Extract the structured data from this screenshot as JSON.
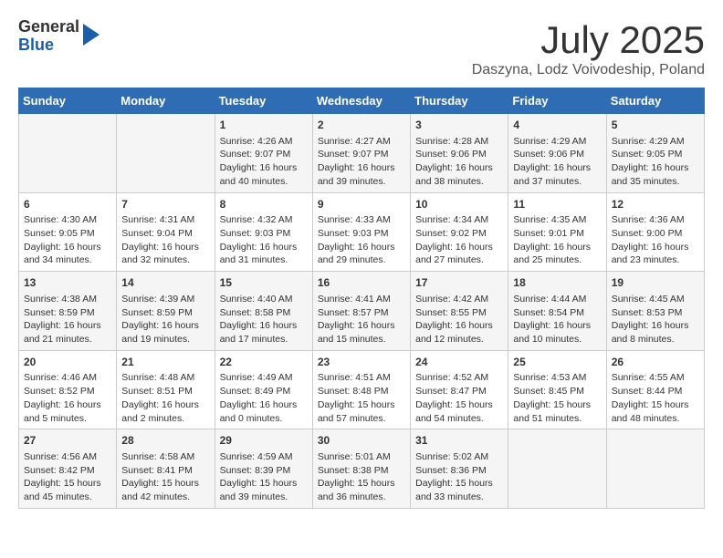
{
  "header": {
    "logo_line1": "General",
    "logo_line2": "Blue",
    "month": "July 2025",
    "location": "Daszyna, Lodz Voivodeship, Poland"
  },
  "days_of_week": [
    "Sunday",
    "Monday",
    "Tuesday",
    "Wednesday",
    "Thursday",
    "Friday",
    "Saturday"
  ],
  "weeks": [
    [
      {
        "day": "",
        "detail": ""
      },
      {
        "day": "",
        "detail": ""
      },
      {
        "day": "1",
        "detail": "Sunrise: 4:26 AM\nSunset: 9:07 PM\nDaylight: 16 hours\nand 40 minutes."
      },
      {
        "day": "2",
        "detail": "Sunrise: 4:27 AM\nSunset: 9:07 PM\nDaylight: 16 hours\nand 39 minutes."
      },
      {
        "day": "3",
        "detail": "Sunrise: 4:28 AM\nSunset: 9:06 PM\nDaylight: 16 hours\nand 38 minutes."
      },
      {
        "day": "4",
        "detail": "Sunrise: 4:29 AM\nSunset: 9:06 PM\nDaylight: 16 hours\nand 37 minutes."
      },
      {
        "day": "5",
        "detail": "Sunrise: 4:29 AM\nSunset: 9:05 PM\nDaylight: 16 hours\nand 35 minutes."
      }
    ],
    [
      {
        "day": "6",
        "detail": "Sunrise: 4:30 AM\nSunset: 9:05 PM\nDaylight: 16 hours\nand 34 minutes."
      },
      {
        "day": "7",
        "detail": "Sunrise: 4:31 AM\nSunset: 9:04 PM\nDaylight: 16 hours\nand 32 minutes."
      },
      {
        "day": "8",
        "detail": "Sunrise: 4:32 AM\nSunset: 9:03 PM\nDaylight: 16 hours\nand 31 minutes."
      },
      {
        "day": "9",
        "detail": "Sunrise: 4:33 AM\nSunset: 9:03 PM\nDaylight: 16 hours\nand 29 minutes."
      },
      {
        "day": "10",
        "detail": "Sunrise: 4:34 AM\nSunset: 9:02 PM\nDaylight: 16 hours\nand 27 minutes."
      },
      {
        "day": "11",
        "detail": "Sunrise: 4:35 AM\nSunset: 9:01 PM\nDaylight: 16 hours\nand 25 minutes."
      },
      {
        "day": "12",
        "detail": "Sunrise: 4:36 AM\nSunset: 9:00 PM\nDaylight: 16 hours\nand 23 minutes."
      }
    ],
    [
      {
        "day": "13",
        "detail": "Sunrise: 4:38 AM\nSunset: 8:59 PM\nDaylight: 16 hours\nand 21 minutes."
      },
      {
        "day": "14",
        "detail": "Sunrise: 4:39 AM\nSunset: 8:59 PM\nDaylight: 16 hours\nand 19 minutes."
      },
      {
        "day": "15",
        "detail": "Sunrise: 4:40 AM\nSunset: 8:58 PM\nDaylight: 16 hours\nand 17 minutes."
      },
      {
        "day": "16",
        "detail": "Sunrise: 4:41 AM\nSunset: 8:57 PM\nDaylight: 16 hours\nand 15 minutes."
      },
      {
        "day": "17",
        "detail": "Sunrise: 4:42 AM\nSunset: 8:55 PM\nDaylight: 16 hours\nand 12 minutes."
      },
      {
        "day": "18",
        "detail": "Sunrise: 4:44 AM\nSunset: 8:54 PM\nDaylight: 16 hours\nand 10 minutes."
      },
      {
        "day": "19",
        "detail": "Sunrise: 4:45 AM\nSunset: 8:53 PM\nDaylight: 16 hours\nand 8 minutes."
      }
    ],
    [
      {
        "day": "20",
        "detail": "Sunrise: 4:46 AM\nSunset: 8:52 PM\nDaylight: 16 hours\nand 5 minutes."
      },
      {
        "day": "21",
        "detail": "Sunrise: 4:48 AM\nSunset: 8:51 PM\nDaylight: 16 hours\nand 2 minutes."
      },
      {
        "day": "22",
        "detail": "Sunrise: 4:49 AM\nSunset: 8:49 PM\nDaylight: 16 hours\nand 0 minutes."
      },
      {
        "day": "23",
        "detail": "Sunrise: 4:51 AM\nSunset: 8:48 PM\nDaylight: 15 hours\nand 57 minutes."
      },
      {
        "day": "24",
        "detail": "Sunrise: 4:52 AM\nSunset: 8:47 PM\nDaylight: 15 hours\nand 54 minutes."
      },
      {
        "day": "25",
        "detail": "Sunrise: 4:53 AM\nSunset: 8:45 PM\nDaylight: 15 hours\nand 51 minutes."
      },
      {
        "day": "26",
        "detail": "Sunrise: 4:55 AM\nSunset: 8:44 PM\nDaylight: 15 hours\nand 48 minutes."
      }
    ],
    [
      {
        "day": "27",
        "detail": "Sunrise: 4:56 AM\nSunset: 8:42 PM\nDaylight: 15 hours\nand 45 minutes."
      },
      {
        "day": "28",
        "detail": "Sunrise: 4:58 AM\nSunset: 8:41 PM\nDaylight: 15 hours\nand 42 minutes."
      },
      {
        "day": "29",
        "detail": "Sunrise: 4:59 AM\nSunset: 8:39 PM\nDaylight: 15 hours\nand 39 minutes."
      },
      {
        "day": "30",
        "detail": "Sunrise: 5:01 AM\nSunset: 8:38 PM\nDaylight: 15 hours\nand 36 minutes."
      },
      {
        "day": "31",
        "detail": "Sunrise: 5:02 AM\nSunset: 8:36 PM\nDaylight: 15 hours\nand 33 minutes."
      },
      {
        "day": "",
        "detail": ""
      },
      {
        "day": "",
        "detail": ""
      }
    ]
  ]
}
